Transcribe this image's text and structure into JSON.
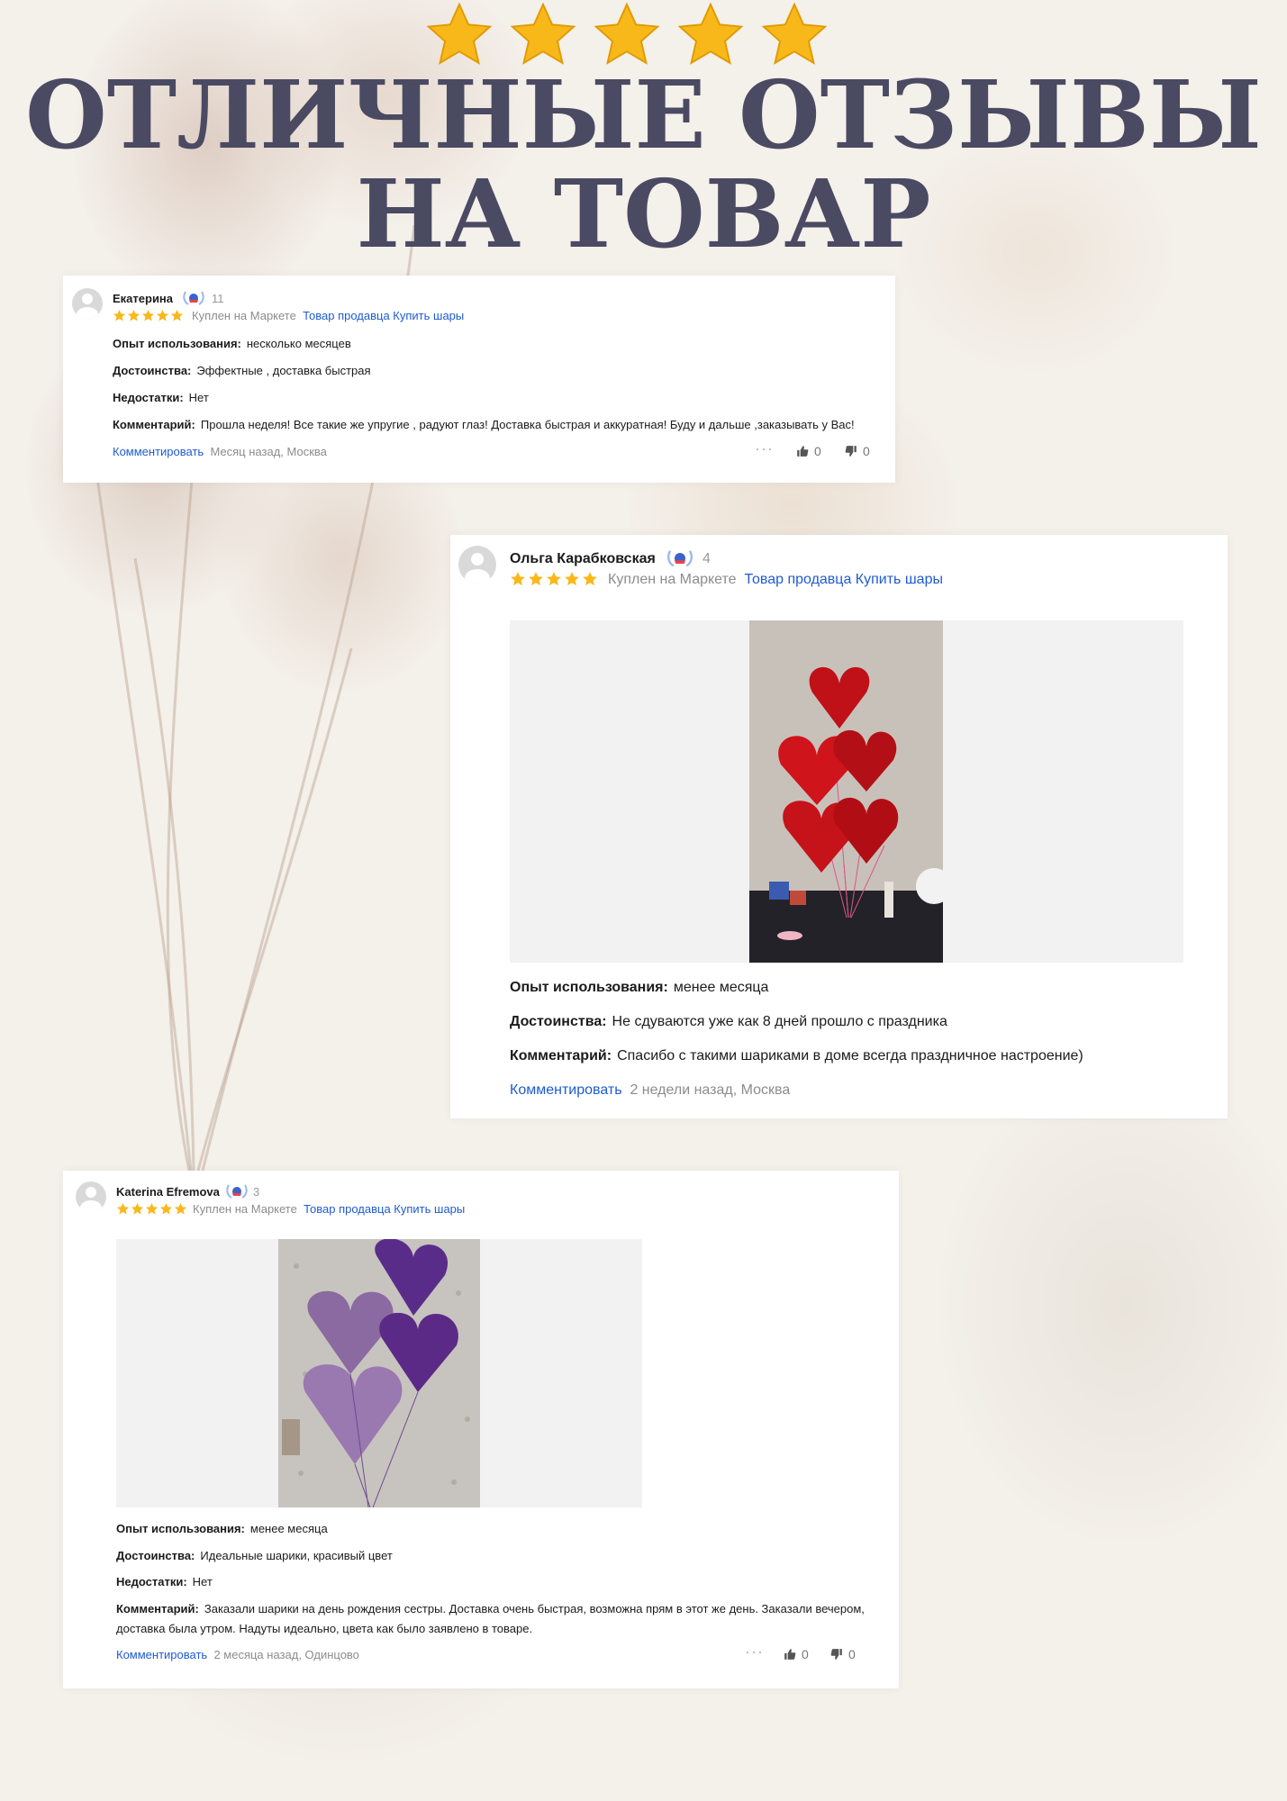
{
  "header": {
    "headline_line1": "ОТЛИЧНЫЕ ОТЗЫВЫ",
    "headline_line2": "НА ТОВАР",
    "star_color": "#f9b81a"
  },
  "colors": {
    "headline": "#4b4a63",
    "link": "#1f5bd1",
    "meta": "#8c8c8c",
    "star": "#f9b81a"
  },
  "reviews": [
    {
      "author": "Екатерина",
      "badge_count": "11",
      "rating": 5,
      "bought": "Куплен на Маркете",
      "seller_link": "Товар продавца Купить шары",
      "fields": [
        {
          "label": "Опыт использования:",
          "value": "несколько месяцев"
        },
        {
          "label": "Достоинства:",
          "value": "Эффектные , доставка быстрая"
        },
        {
          "label": "Недостатки:",
          "value": "Нет"
        },
        {
          "label": "Комментарий:",
          "value": "Прошла неделя! Все такие же упругие , радуют глаз! Доставка быстрая и аккуратная! Буду и дальше ,заказывать у Вас!"
        }
      ],
      "comment_link": "Комментировать",
      "meta": "Месяц назад, Москва",
      "likes": "0",
      "dislikes": "0"
    },
    {
      "author": "Ольга Карабковская",
      "badge_count": "4",
      "rating": 5,
      "bought": "Куплен на Маркете",
      "seller_link": "Товар продавца Купить шары",
      "photo_icon": "red-heart-balloons-photo",
      "fields": [
        {
          "label": "Опыт использования:",
          "value": "менее месяца"
        },
        {
          "label": "Достоинства:",
          "value": "Не сдуваются уже как 8 дней прошло с праздника"
        },
        {
          "label": "Комментарий:",
          "value": "Спасибо с такими шариками в доме всегда праздничное настроение)"
        }
      ],
      "comment_link": "Комментировать",
      "meta": "2 недели назад, Москва"
    },
    {
      "author": "Katerina Efremova",
      "badge_count": "3",
      "rating": 5,
      "bought": "Куплен на Маркете",
      "seller_link": "Товар продавца Купить шары",
      "photo_icon": "purple-heart-balloons-photo",
      "fields": [
        {
          "label": "Опыт использования:",
          "value": "менее месяца"
        },
        {
          "label": "Достоинства:",
          "value": "Идеальные шарики, красивый цвет"
        },
        {
          "label": "Недостатки:",
          "value": "Нет"
        },
        {
          "label": "Комментарий:",
          "value": "Заказали шарики на день рождения сестры. Доставка очень быстрая, возможна прям в этот же день. Заказали вечером,"
        },
        {
          "label": "",
          "value": "доставка была утром. Надуты идеально, цвета как было заявлено в товаре."
        }
      ],
      "comment_link": "Комментировать",
      "meta": "2 месяца назад, Одинцово",
      "likes": "0",
      "dislikes": "0"
    }
  ]
}
